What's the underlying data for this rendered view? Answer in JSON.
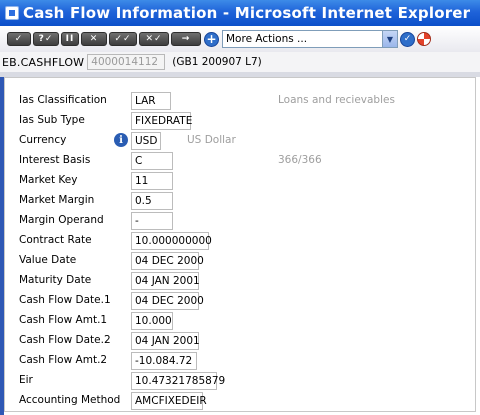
{
  "window": {
    "title": "Cash Flow Information - Microsoft Internet Explorer"
  },
  "toolbar": {
    "buttons": [
      {
        "label": "✓",
        "icon": "check-icon"
      },
      {
        "label": "?✓",
        "icon": "validate-icon"
      },
      {
        "label": "II",
        "icon": "hold-icon"
      },
      {
        "label": "✕",
        "icon": "delete-icon"
      },
      {
        "label": "✓✓",
        "icon": "authorise-icon"
      },
      {
        "label": "✕✓",
        "icon": "reverse-icon"
      },
      {
        "label": "→",
        "icon": "next-icon"
      }
    ],
    "more_actions": "More Actions ..."
  },
  "record": {
    "application": "EB.CASHFLOW",
    "id": "4000014112",
    "reference": "(GB1 200907 L7)"
  },
  "fields": [
    {
      "label": "Ias Classification",
      "value": "LAR",
      "description": "Loans and recievables"
    },
    {
      "label": "Ias Sub Type",
      "value": "FIXEDRATE"
    },
    {
      "label": "Currency",
      "value": "USD",
      "description": "US Dollar"
    },
    {
      "label": "Interest Basis",
      "value": "C",
      "description": "366/366"
    },
    {
      "label": "Market Key",
      "value": "11"
    },
    {
      "label": "Market Margin",
      "value": "0.5"
    },
    {
      "label": "Margin Operand",
      "value": "-"
    },
    {
      "label": "Contract Rate",
      "value": "10.000000000"
    },
    {
      "label": "Value Date",
      "value": "04 DEC 2000"
    },
    {
      "label": "Maturity Date",
      "value": "04 JAN 2001"
    },
    {
      "label": "Cash Flow Date.1",
      "value": "04 DEC 2000"
    },
    {
      "label": "Cash Flow Amt.1",
      "value": "10.000"
    },
    {
      "label": "Cash Flow Date.2",
      "value": "04 JAN 2001"
    },
    {
      "label": "Cash Flow Amt.2",
      "value": "-10.084.72"
    },
    {
      "label": "Eir",
      "value": "10.47321785879"
    },
    {
      "label": "Accounting Method",
      "value": "AMCFIXEDEIR"
    }
  ],
  "colors": {
    "titlebar": "#1f63d9",
    "description_text": "#9e9e9e"
  }
}
